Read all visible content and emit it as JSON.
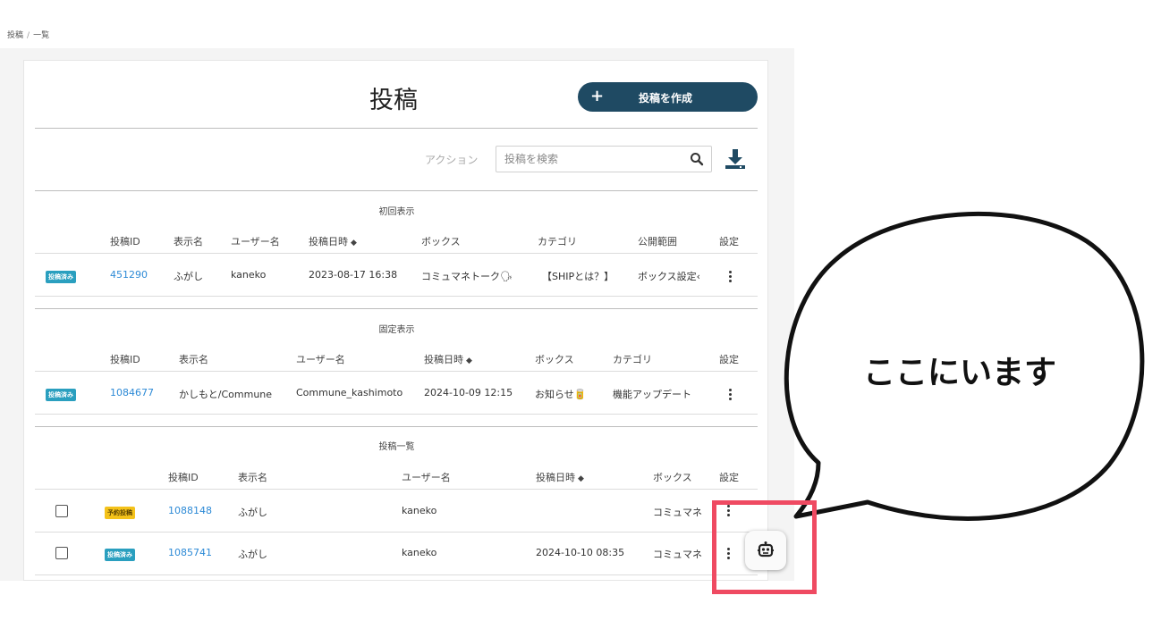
{
  "breadcrumb": {
    "root": "投稿",
    "sep": "/",
    "current": "一覧"
  },
  "page": {
    "title": "投稿",
    "create_label": "投稿を作成",
    "create_icon": "plus-icon"
  },
  "toolbar": {
    "action_label": "アクション",
    "search_placeholder": "投稿を検索",
    "search_icon": "search-icon",
    "download_icon": "download-icon"
  },
  "colors": {
    "primary": "#1f4a63",
    "link": "#2d8ad6",
    "badge_published": "#2a9fbf",
    "badge_scheduled": "#f4c21a",
    "highlight": "#ef4a62"
  },
  "first_display": {
    "title": "初回表示",
    "headers": {
      "id": "投稿ID",
      "display_name": "表示名",
      "user_name": "ユーザー名",
      "posted_at": "投稿日時",
      "sort": "◆",
      "box": "ボックス",
      "category": "カテゴリ",
      "visibility": "公開範囲",
      "settings": "設定"
    },
    "row": {
      "status": "投稿済み",
      "id": "451290",
      "display_name": "ふがし",
      "user_name": "kaneko",
      "posted_at": "2023-08-17 16:38",
      "box": "コミュマネトーク🗣",
      "category": "【SHIPとは？】",
      "visibility": "ボックス設定‹"
    }
  },
  "pinned_display": {
    "title": "固定表示",
    "headers": {
      "id": "投稿ID",
      "display_name": "表示名",
      "user_name": "ユーザー名",
      "posted_at": "投稿日時",
      "sort": "◆",
      "box": "ボックス",
      "category": "カテゴリ",
      "settings": "設定"
    },
    "row": {
      "status": "投稿済み",
      "id": "1084677",
      "display_name": "かしもと/Commune",
      "user_name": "Commune_kashimoto",
      "posted_at": "2024-10-09 12:15",
      "box": "お知らせ🥫",
      "category": "機能アップデート"
    }
  },
  "post_list": {
    "title": "投稿一覧",
    "headers": {
      "id": "投稿ID",
      "display_name": "表示名",
      "user_name": "ユーザー名",
      "posted_at": "投稿日時",
      "sort": "◆",
      "box": "ボックス",
      "settings": "設定"
    },
    "rows": [
      {
        "status": "予約投稿",
        "id": "1088148",
        "display_name": "ふがし",
        "user_name": "kaneko",
        "posted_at": "",
        "box": "コミュマネ"
      },
      {
        "status": "投稿済み",
        "id": "1085741",
        "display_name": "ふがし",
        "user_name": "kaneko",
        "posted_at": "2024-10-10 08:35",
        "box": "コミュマネ"
      }
    ]
  },
  "assistant": {
    "icon": "robot-icon"
  },
  "callout": {
    "text": "ここにいます"
  }
}
